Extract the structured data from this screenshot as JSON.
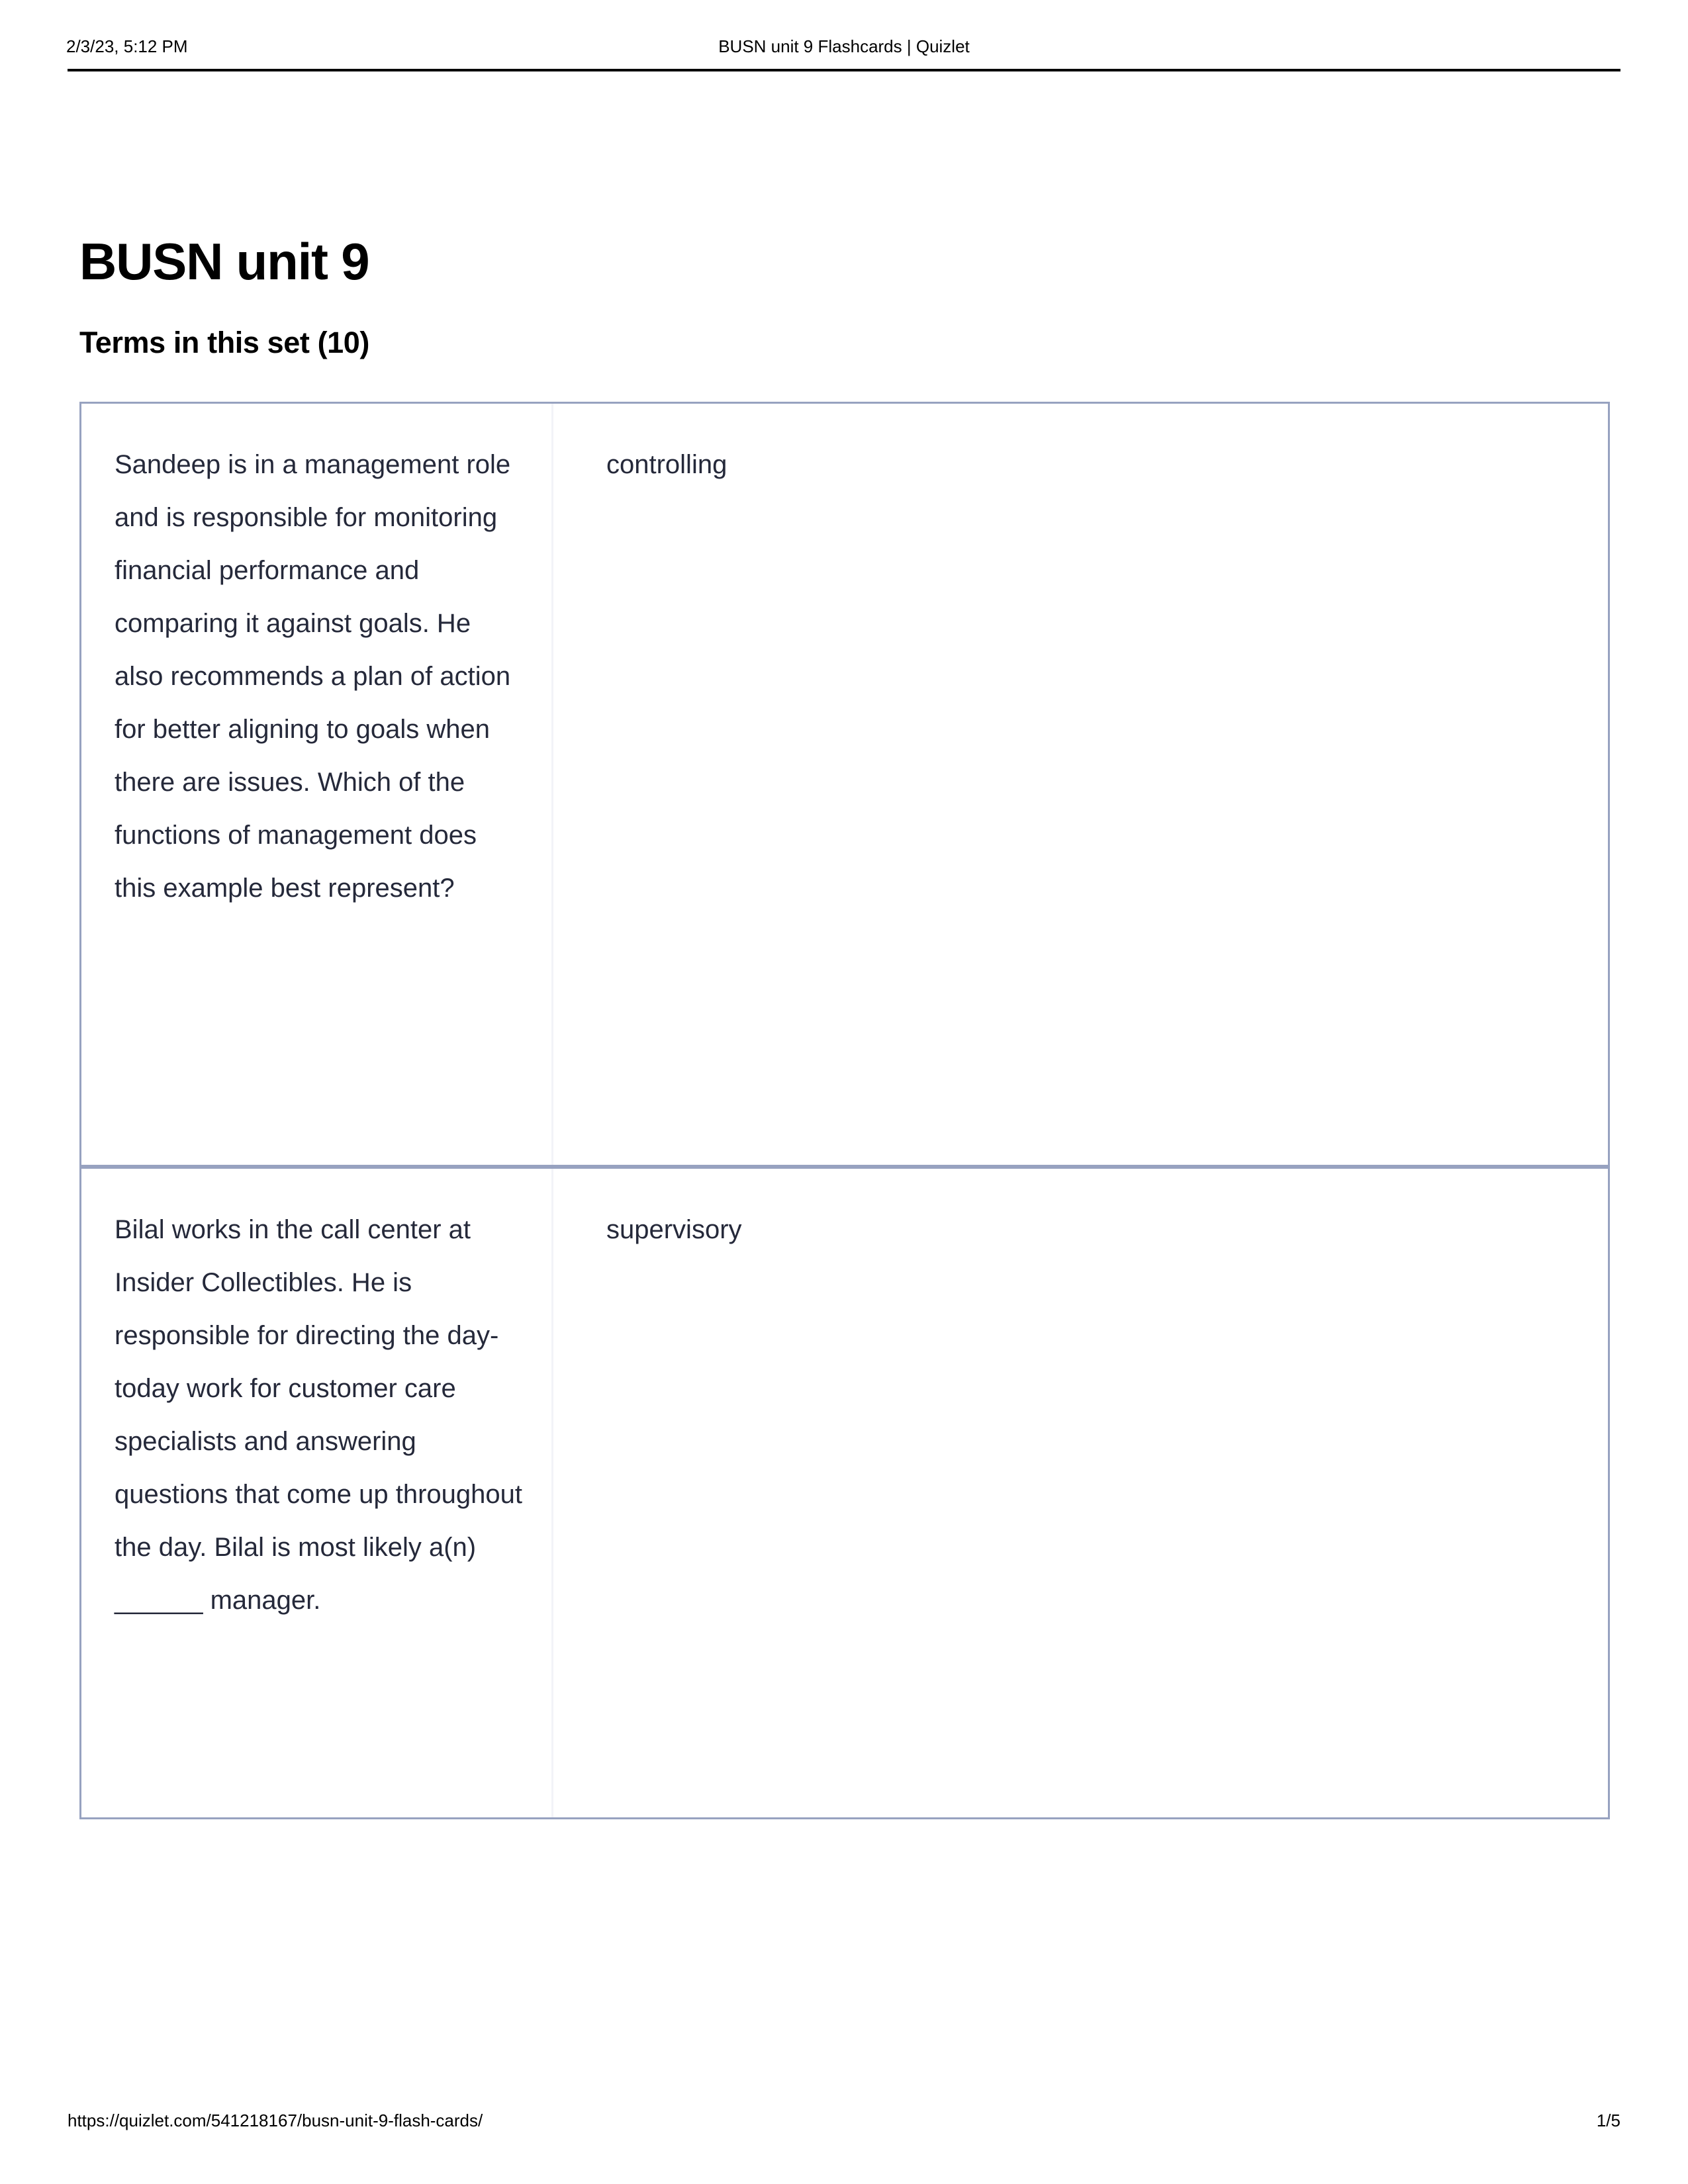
{
  "print_header": {
    "timestamp": "2/3/23, 5:12 PM",
    "document_title": "BUSN unit 9 Flashcards | Quizlet"
  },
  "page": {
    "set_title": "BUSN unit 9",
    "section_heading": "Terms in this set (10)"
  },
  "terms": [
    {
      "term": "Sandeep is in a management role and is responsible for monitoring financial performance and comparing it against goals. He also recommends a plan of action for better aligning to goals when there are issues. Which of the functions of management does this example best represent?",
      "definition": "controlling"
    },
    {
      "term": "Bilal works in the call center at Insider Collectibles. He is responsible for directing the day-today work for customer care specialists and answering questions that come up throughout the day. Bilal is most likely a(n) ______ manager.",
      "definition": "supervisory"
    }
  ],
  "print_footer": {
    "url": "https://quizlet.com/541218167/busn-unit-9-flash-cards/",
    "page_number": "1/5"
  },
  "colors": {
    "text": "#25293a",
    "card_border": "#97a2c0",
    "column_divider": "#f2f3f8",
    "header_rule": "#000000"
  }
}
